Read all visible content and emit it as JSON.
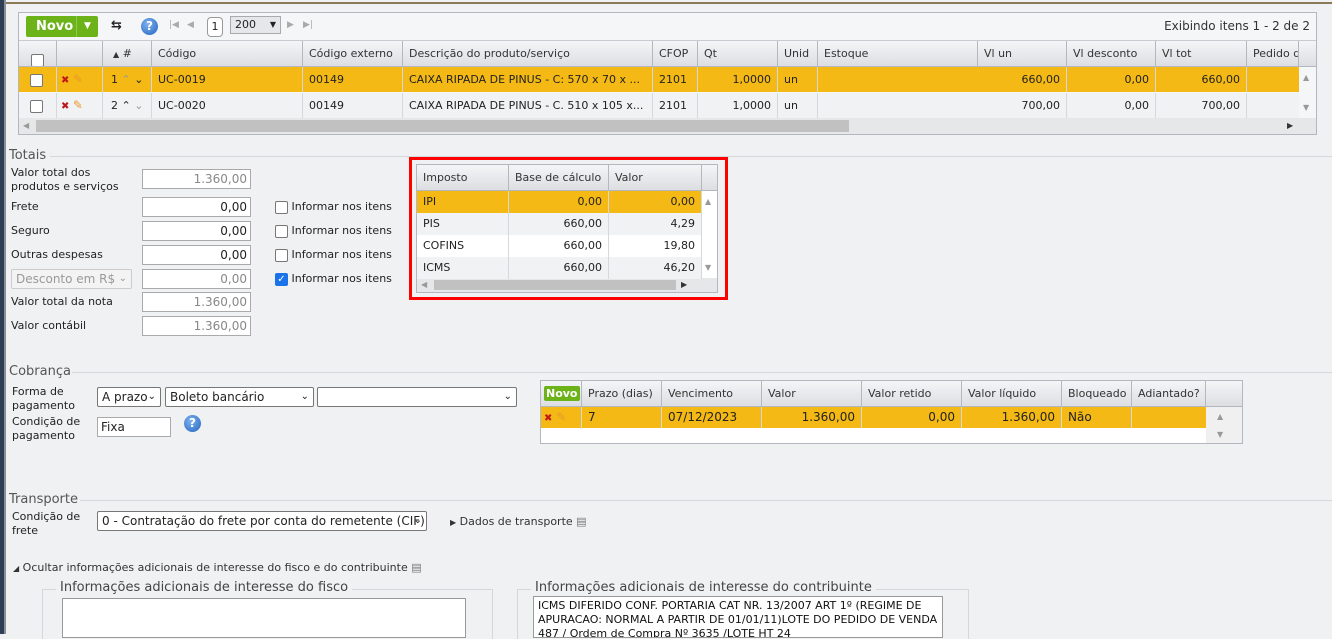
{
  "toolbar": {
    "new_label": "Novo",
    "page": "1",
    "page_size": "200",
    "summary": "Exibindo itens 1 - 2 de 2"
  },
  "items": {
    "columns": [
      "#",
      "Código",
      "Código externo",
      "Descrição do produto/serviço",
      "CFOP",
      "Qt",
      "Unid",
      "Estoque",
      "Vl un",
      "Vl desconto",
      "Vl tot",
      "Pedido de"
    ],
    "rows": [
      {
        "n": "1",
        "codigo": "UC-0019",
        "ext": "00149",
        "desc": "CAIXA RIPADA DE PINUS - C: 570 x 70 x ...",
        "cfop": "2101",
        "qt": "1,0000",
        "unid": "un",
        "estoque": "",
        "vlun": "660,00",
        "vldesc": "0,00",
        "vltot": "660,00",
        "pedido": ""
      },
      {
        "n": "2",
        "codigo": "UC-0020",
        "ext": "00149",
        "desc": "CAIXA RIPADA DE PINUS - C. 510 x 105 x...",
        "cfop": "2101",
        "qt": "1,0000",
        "unid": "un",
        "estoque": "",
        "vlun": "700,00",
        "vldesc": "0,00",
        "vltot": "700,00",
        "pedido": ""
      }
    ]
  },
  "totais": {
    "title": "Totais",
    "fields": [
      {
        "label": "Valor total dos produtos e serviços",
        "value": "1.360,00"
      },
      {
        "label": "Frete",
        "value": "0,00",
        "informar": "Informar nos itens",
        "checked": false
      },
      {
        "label": "Seguro",
        "value": "0,00",
        "informar": "Informar nos itens",
        "checked": false
      },
      {
        "label": "Outras despesas",
        "value": "0,00",
        "informar": "Informar nos itens",
        "checked": false
      },
      {
        "label": "Desconto em R$",
        "value": "0,00",
        "informar": "Informar nos itens",
        "checked": true
      },
      {
        "label": "Valor total da nota",
        "value": "1.360,00"
      },
      {
        "label": "Valor contábil",
        "value": "1.360,00"
      }
    ]
  },
  "impostos": {
    "columns": [
      "Imposto",
      "Base de cálculo",
      "Valor"
    ],
    "rows": [
      [
        "IPI",
        "0,00",
        "0,00"
      ],
      [
        "PIS",
        "660,00",
        "4,29"
      ],
      [
        "COFINS",
        "660,00",
        "19,80"
      ],
      [
        "ICMS",
        "660,00",
        "46,20"
      ]
    ]
  },
  "cobranca": {
    "title": "Cobrança",
    "forma_label": "Forma de pagamento",
    "forma1": "A prazo",
    "forma2": "Boleto bancário",
    "forma3": "",
    "condicao_label": "Condição de pagamento",
    "condicao": "Fixa",
    "parcelas": {
      "new_label": "Novo",
      "columns": [
        "Prazo (dias)",
        "Vencimento",
        "Valor",
        "Valor retido",
        "Valor líquido",
        "Bloqueado",
        "Adiantado?"
      ],
      "rows": [
        [
          "7",
          "07/12/2023",
          "1.360,00",
          "0,00",
          "1.360,00",
          "Não",
          ""
        ]
      ]
    }
  },
  "transporte": {
    "title": "Transporte",
    "condicao_label": "Condição de frete",
    "condicao": "0 - Contratação do frete por conta do remetente (CIF)",
    "dados_link": "Dados de transporte"
  },
  "adicionais": {
    "toggle": "Ocultar informações adicionais de interesse do fisco e do contribuinte",
    "fisco_title": "Informações adicionais de interesse do fisco",
    "fisco_text": "",
    "contrib_title": "Informações adicionais de interesse do contribuinte",
    "contrib_text": "ICMS DIFERIDO CONF. PORTARIA CAT NR. 13/2007 ART 1º (REGIME DE APURACAO: NORMAL A PARTIR DE 01/01/11)LOTE DO PEDIDO DE VENDA 487 / Ordem de Compra Nº 3635 /LOTE HT 24"
  }
}
